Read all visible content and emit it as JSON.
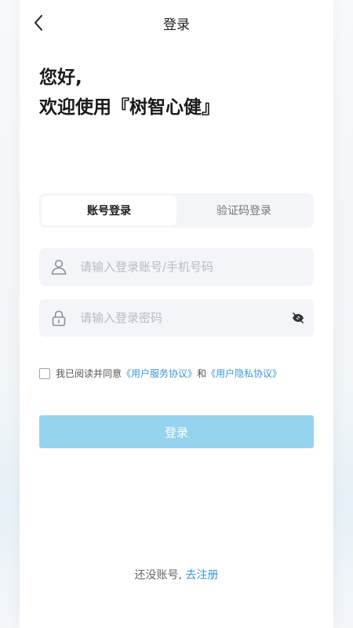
{
  "nav": {
    "title": "登录",
    "back_icon": "chevron-left-icon"
  },
  "greeting": {
    "line1": "您好,",
    "line2": "欢迎使用『树智心健』"
  },
  "tabs": [
    {
      "label": "账号登录",
      "active": true
    },
    {
      "label": "验证码登录",
      "active": false
    }
  ],
  "form": {
    "account": {
      "placeholder": "请输入登录账号/手机号码",
      "value": "",
      "icon": "user-icon"
    },
    "password": {
      "placeholder": "请输入登录密码",
      "value": "",
      "icon": "lock-icon",
      "toggle_icon": "eye-off-icon"
    }
  },
  "agreement": {
    "prefix": "我已阅读并同意",
    "service_link": "《用户服务协议》",
    "conjunction": "和",
    "privacy_link": "《用户隐私协议》",
    "checked": false
  },
  "login_button": {
    "label": "登录"
  },
  "register": {
    "prompt": "还没账号,",
    "link": "去注册"
  },
  "colors": {
    "accent": "#3a9ad8",
    "button_bg": "#96d3ef",
    "field_bg": "#f3f5f8"
  }
}
